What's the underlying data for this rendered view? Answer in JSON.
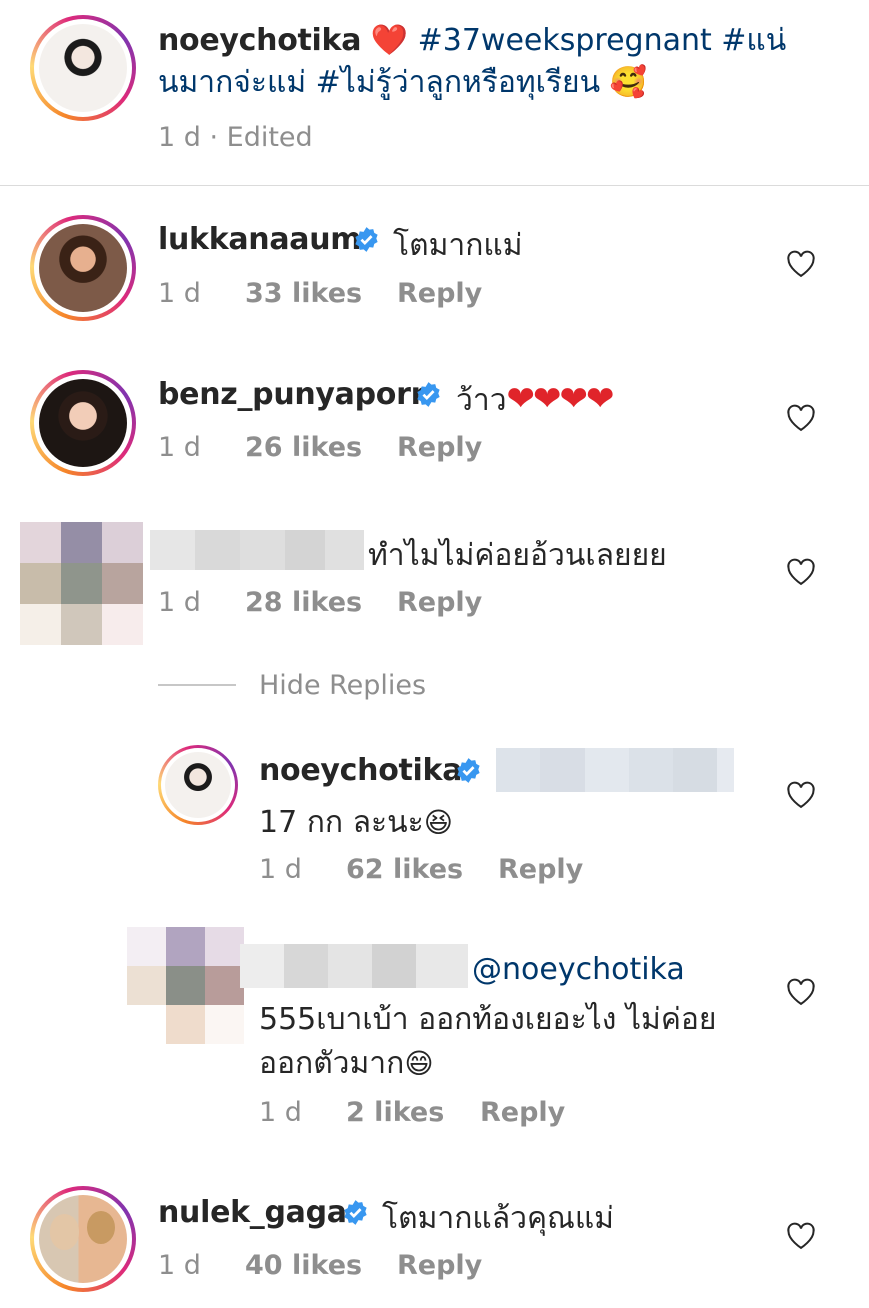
{
  "post": {
    "username": "noeychotika",
    "heart": "❤️",
    "caption_line1": "#37weekspregnant #แน่",
    "caption_line2": "นมากจ่ะแม่ #ไม่รู้ว่าลูกหรือทุเรียน",
    "caption_emoji": "🥰",
    "time": "1 d · Edited"
  },
  "comments": [
    {
      "username": "lukkanaaum",
      "text": "โตมากแม่",
      "time": "1 d",
      "likes": "33 likes",
      "reply": "Reply"
    },
    {
      "username": "benz_punyaporn",
      "text": "ว้าว",
      "hearts": "❤❤❤❤",
      "time": "1 d",
      "likes": "26 likes",
      "reply": "Reply"
    },
    {
      "text": "ทำไมไม่ค่อยอ้วนเลยยย",
      "time": "1 d",
      "likes": "28 likes",
      "reply": "Reply"
    }
  ],
  "hide_replies": "Hide Replies",
  "replies": [
    {
      "username": "noeychotika",
      "text": "17 กก ละนะ",
      "emoji": "😆",
      "time": "1 d",
      "likes": "62 likes",
      "reply": "Reply"
    },
    {
      "mention": "@noeychotika",
      "text_line1": "555เบาเบ้า ออกท้องเยอะไง ไม่ค่อย",
      "text_line2": "ออกตัวมาก",
      "emoji": "😄",
      "time": "1 d",
      "likes": "2 likes",
      "reply": "Reply"
    }
  ],
  "last_comment": {
    "username": "nulek_gaga",
    "text": "โตมากแล้วคุณแม่",
    "time": "1 d",
    "likes": "40 likes",
    "reply": "Reply"
  },
  "colors": {
    "text": "#262626",
    "meta": "#8e8e8e",
    "hashtag": "#00376b",
    "verified": "#3897f0",
    "heart": "#e0242a"
  }
}
